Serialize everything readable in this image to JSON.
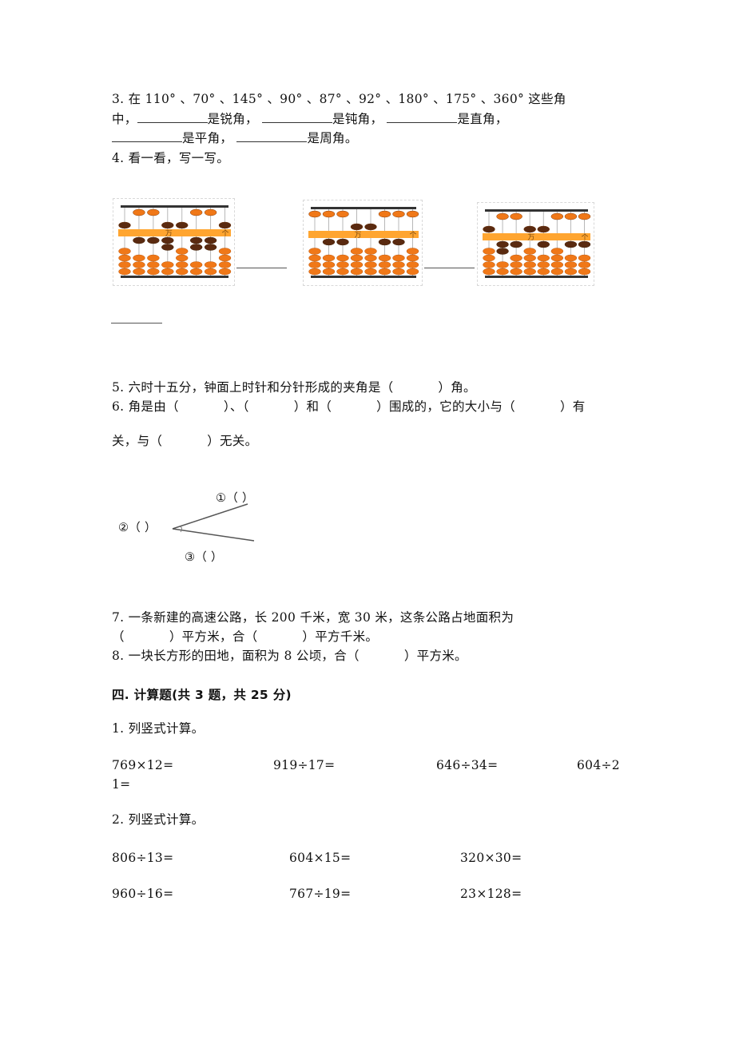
{
  "q3": {
    "line1": "3. 在 110° 、70° 、145° 、90° 、87° 、92° 、180° 、175° 、360° 这些角",
    "line2_prefix": "中，",
    "acute": "是锐角，",
    "obtuse": "是钝角，",
    "right": "是直角，",
    "straight": "是平角，",
    "full": "是周角。"
  },
  "q4": {
    "title": "4. 看一看，写一写。",
    "abaci": [
      {
        "label_wan": "万",
        "label_ge": "个",
        "digits": [
          5,
          1,
          1,
          7,
          5,
          2,
          2,
          5
        ]
      },
      {
        "label_wan": "万",
        "label_ge": "个",
        "digits": [
          0,
          1,
          1,
          5,
          5,
          1,
          1,
          0
        ]
      },
      {
        "label_wan": "万",
        "label_ge": "个",
        "digits": [
          5,
          2,
          1,
          5,
          6,
          0,
          1,
          1
        ]
      }
    ]
  },
  "q5": {
    "text": "5. 六时十五分，钟面上时针和分针形成的夹角是（",
    "suffix": "）角。"
  },
  "q6": {
    "p1": "6. 角是由（",
    "p2": "）、（",
    "p3": "）和（",
    "p4": "）围成的，它的大小与（",
    "p5": "）有",
    "line2a": "关，与（",
    "line2b": "）无关。"
  },
  "angle_figure": {
    "label1": "①（  ）",
    "label2": "②（  ）",
    "label3": "③（  ）"
  },
  "q7": {
    "line1": "7. 一条新建的高速公路，长 200 千米，宽 30 米，这条公路占地面积为",
    "line2a": "（",
    "line2b": "）平方米，合（",
    "line2c": "）平方千米。"
  },
  "q8": {
    "a": "8. 一块长方形的田地，面积为 8 公顷，合（",
    "b": "）平方米。"
  },
  "section4": {
    "title": "四. 计算题(共 3 题，共 25 分)",
    "q1": {
      "title": "1. 列竖式计算。",
      "items": [
        "769×12=",
        "919÷17=",
        "646÷34=",
        "604÷2"
      ],
      "wrap": "1="
    },
    "q2": {
      "title": "2. 列竖式计算。",
      "row1": [
        "806÷13=",
        "604×15=",
        "320×30="
      ],
      "row2": [
        "960÷16=",
        "767÷19=",
        "23×128="
      ]
    }
  },
  "colors": {
    "bead_active": "#5a2a10",
    "bead_idle": "#f07818",
    "beam": "#ffa530",
    "frame": "#333333"
  }
}
